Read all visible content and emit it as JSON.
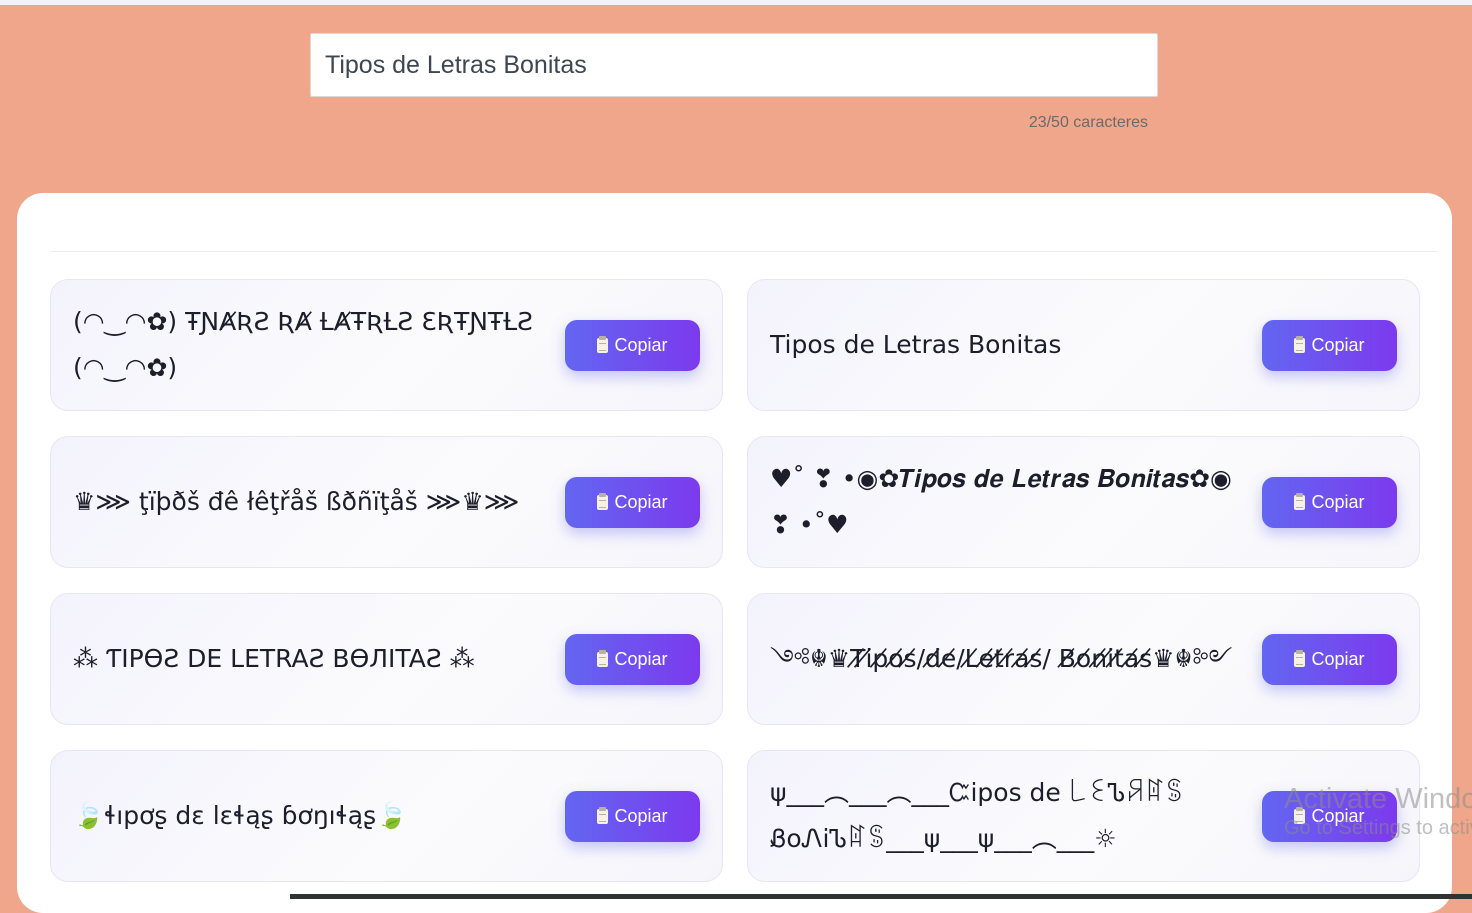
{
  "input": {
    "value": "Tipos de Letras Bonitas",
    "counter": "23/50 caracteres"
  },
  "copy_label": "Copiar",
  "icons": {
    "copy": "clipboard-icon"
  },
  "results": [
    {
      "text": "(◠‿◠✿) ŦƝȺƦƧ ƦȺ ȽȺŦƦȽƧ ƐƦŦƝŦȽƧ (◠‿◠✿)"
    },
    {
      "text": "Tipos de Letras Bonitas"
    },
    {
      "text": "♛⋙ ţïþðš đê łêţřåš ßðñïţåš ⋙♛⋙"
    },
    {
      "text": "♥˚ ❣ •◉✿𝑻𝒊𝒑𝒐𝒔 𝒅𝒆 𝑳𝒆𝒕𝒓𝒂𝒔 𝑩𝒐𝒏𝒊𝒕𝒂𝒔✿◉ ❣ •˚♥"
    },
    {
      "text": "⁂ ƬIPƟƧ DE LETRAƧ BƟЛITAƧ ⁂"
    },
    {
      "text": "༺☬♛T̸i̸p̸o̸s̸/d̸e̸/L̸e̸t̸r̸a̸s̸/ B̸o̸n̸i̸t̸a̸s̸♛☬༻"
    },
    {
      "text": "🍃ɬıpơʂ dɛ lɛɬąʂ ɓơŋıɬąʂ🍃"
    },
    {
      "text": "ψ___︵___︵___Ꮸipos de ꒒ꏂᏖꋪꍏꌚ ᏰoᏁiᏖꍏꌚ___ψ___ψ___︵___☼"
    }
  ],
  "watermark": {
    "title": "Activate Windows",
    "subtitle": "Go to Settings to activate Windows."
  }
}
